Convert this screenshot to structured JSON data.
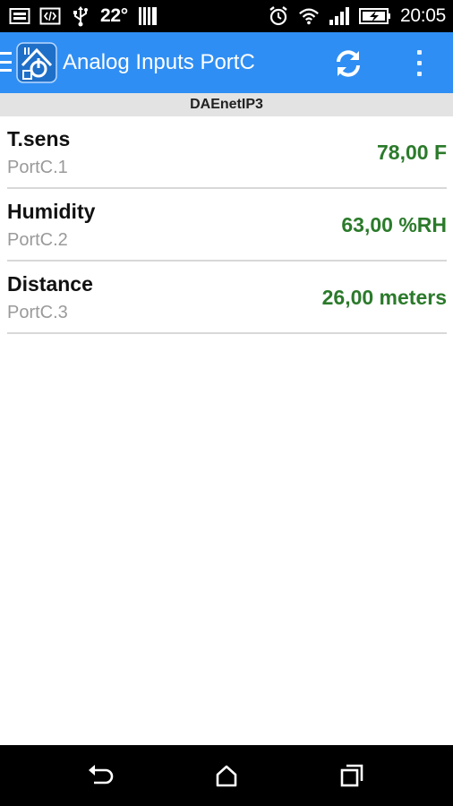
{
  "status_bar": {
    "temperature": "22°",
    "time": "20:05",
    "left_icons": [
      "gallery-icon",
      "code-icon",
      "usb-icon"
    ],
    "right_icons": [
      "alarm-icon",
      "wifi-icon",
      "signal-icon",
      "battery-charging-icon"
    ]
  },
  "app_bar": {
    "title": "Analog Inputs PortC",
    "icons": [
      "menu-icon",
      "app-logo-icon",
      "refresh-icon",
      "overflow-menu-icon"
    ],
    "color": "#2f8ef3"
  },
  "device": {
    "name": "DAEnetIP3"
  },
  "inputs": [
    {
      "name": "T.sens",
      "port": "PortC.1",
      "value": "78,00 F"
    },
    {
      "name": "Humidity",
      "port": "PortC.2",
      "value": "63,00 %RH"
    },
    {
      "name": "Distance",
      "port": "PortC.3",
      "value": "26,00 meters"
    }
  ],
  "value_color": "#2b7a2b",
  "nav_bar": {
    "icons": [
      "back-icon",
      "home-icon",
      "recents-icon"
    ]
  }
}
